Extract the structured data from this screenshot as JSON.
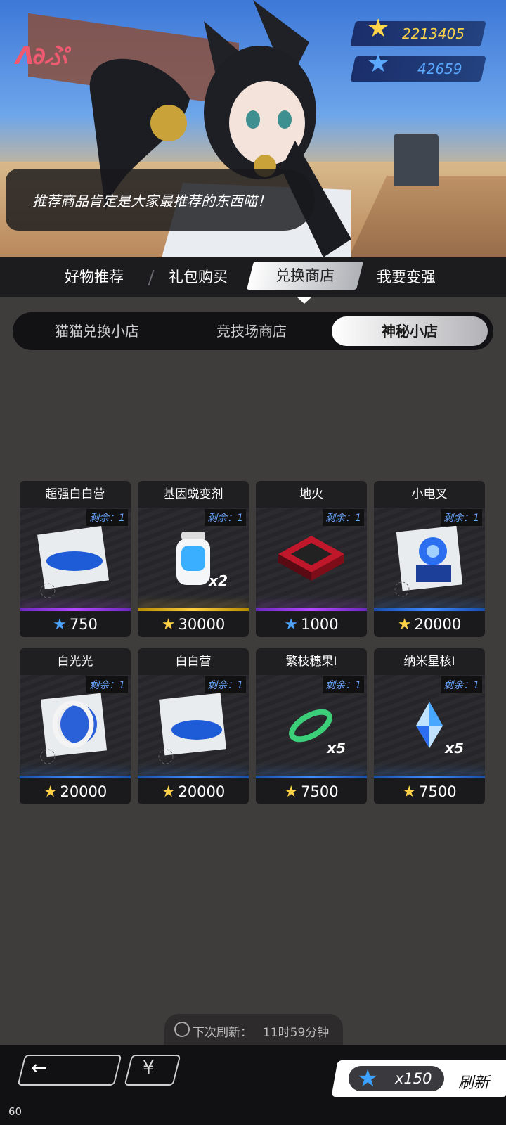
{
  "header": {
    "logo_text": "ᐱ∂ぷ",
    "currencies": [
      {
        "icon": "gold-star",
        "value": "2213405",
        "color": "#ffd54a"
      },
      {
        "icon": "blue-star",
        "value": "42659",
        "color": "#5aa9ff"
      }
    ],
    "speech": "推荐商品肯定是大家最推荐的东西喵！"
  },
  "main_tabs": [
    "好物推荐",
    "礼包购买",
    "兑换商店",
    "我要变强"
  ],
  "active_main_tab": "兑换商店",
  "sub_tabs": [
    "猫猫兑换小店",
    "竞技场商店",
    "神秘小店"
  ],
  "active_sub_tab": "神秘小店",
  "items": [
    {
      "name": "超强白白营",
      "remaining": "剩余：1",
      "price": "750",
      "currency": "blue-star",
      "rarity": "purple",
      "icon": "card-blue-disc"
    },
    {
      "name": "基因蜕变剂",
      "remaining": "剩余：1",
      "price": "30000",
      "currency": "gold-star",
      "rarity": "gold",
      "qty": "x2",
      "icon": "potion-bottle"
    },
    {
      "name": "地火",
      "remaining": "剩余：1",
      "price": "1000",
      "currency": "blue-star",
      "rarity": "purple",
      "icon": "red-chip"
    },
    {
      "name": "小电叉",
      "remaining": "剩余：1",
      "price": "20000",
      "currency": "gold-star",
      "rarity": "blue",
      "icon": "card-robot"
    },
    {
      "name": "白光光",
      "remaining": "剩余：1",
      "price": "20000",
      "currency": "gold-star",
      "rarity": "blue",
      "icon": "card-white-orb"
    },
    {
      "name": "白白营",
      "remaining": "剩余：1",
      "price": "20000",
      "currency": "gold-star",
      "rarity": "blue",
      "icon": "card-blue-disc"
    },
    {
      "name": "繁枝穗果Ⅰ",
      "remaining": "剩余：1",
      "price": "7500",
      "currency": "gold-star",
      "rarity": "blue",
      "qty": "x5",
      "icon": "green-ring"
    },
    {
      "name": "纳米星核Ⅰ",
      "remaining": "剩余：1",
      "price": "7500",
      "currency": "gold-star",
      "rarity": "blue",
      "qty": "x5",
      "icon": "blue-crystal"
    }
  ],
  "refresh_timer": {
    "label": "下次刷新：",
    "value": "11时59分钟"
  },
  "bottom": {
    "back_icon": "arrow-left-icon",
    "yen_label": "¥",
    "refresh_cost": "x150",
    "refresh_label": "刷新"
  },
  "fps": "60"
}
